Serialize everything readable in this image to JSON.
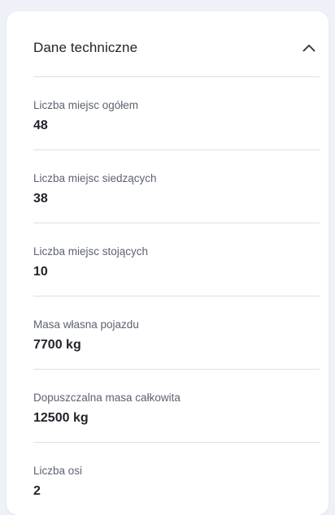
{
  "section": {
    "title": "Dane techniczne",
    "toggle_icon": "chevron-up-icon"
  },
  "specs": [
    {
      "label": "Liczba miejsc ogółem",
      "value": "48"
    },
    {
      "label": "Liczba miejsc siedzących",
      "value": "38"
    },
    {
      "label": "Liczba miejsc stojących",
      "value": "10"
    },
    {
      "label": "Masa własna pojazdu",
      "value": "7700 kg"
    },
    {
      "label": "Dopuszczalna masa całkowita",
      "value": "12500 kg"
    },
    {
      "label": "Liczba osi",
      "value": "2"
    }
  ]
}
